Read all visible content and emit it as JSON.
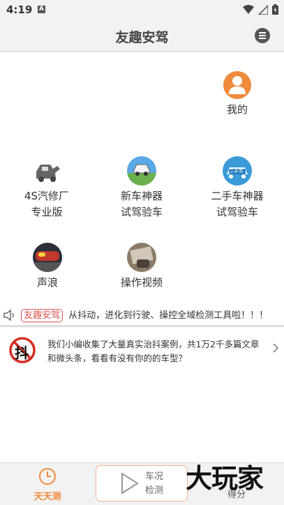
{
  "status_bar": {
    "time": "4:19",
    "notif_letter": "A"
  },
  "header": {
    "title": "友趣安驾"
  },
  "profile": {
    "label": "我的"
  },
  "tiles": [
    {
      "line1": "4S汽修厂",
      "line2": "专业版"
    },
    {
      "line1": "新车神器",
      "line2": "试驾验车"
    },
    {
      "line1": "二手车神器",
      "line2": "试驾验车",
      "icon_text": "二手车"
    },
    {
      "line1": "声浪"
    },
    {
      "line1": "操作视频"
    }
  ],
  "notice": {
    "badge": "友趣安驾",
    "text": "从抖动，进化到行驶、操控全域检测工具啦！！！"
  },
  "article": {
    "icon_text": "抖",
    "text": "我们小编收集了大量真实治抖案例，共1万2千多篇文章和微头条，看看有没有你的的车型？"
  },
  "bottom_nav": {
    "tab1": "天天测",
    "check_line1": "车况",
    "check_line2": "检测",
    "tab3": "得分"
  },
  "watermark": "大玩家",
  "colors": {
    "accent": "#f08a3c",
    "header_bg": "#f2f2f2",
    "badge_red": "#d9534f"
  }
}
